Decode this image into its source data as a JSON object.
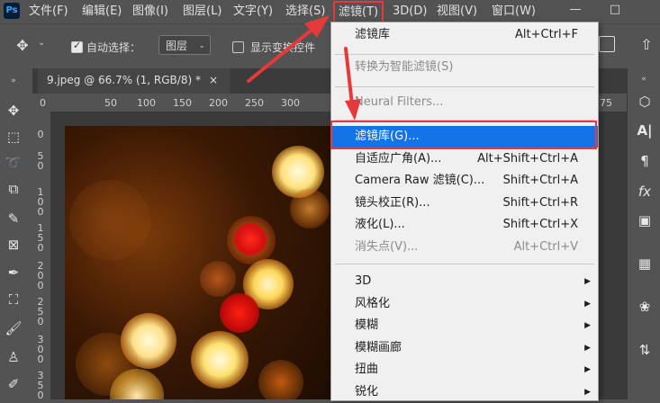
{
  "menubar": {
    "logo": "Ps",
    "items": [
      "文件(F)",
      "编辑(E)",
      "图像(I)",
      "图层(L)",
      "文字(Y)",
      "选择(S)",
      "滤镜(T)",
      "3D(D)",
      "视图(V)",
      "窗口(W)"
    ],
    "window_buttons": [
      "—",
      "□"
    ]
  },
  "options": {
    "auto_select_label": "自动选择：",
    "auto_select_checked": true,
    "layer_select_value": "图层",
    "show_transform_label": "显示变换控件",
    "show_transform_checked": false
  },
  "doc_tab": {
    "title": "9.jpeg @ 66.7% (1, RGB/8) *",
    "close": "×"
  },
  "ruler": {
    "top_labels": [
      "0",
      "50",
      "100",
      "150",
      "200",
      "250",
      "300",
      "75"
    ],
    "left_labels": [
      "0",
      "5",
      "0",
      "1",
      "0",
      "0",
      "1",
      "5",
      "0",
      "2",
      "0",
      "0",
      "2",
      "5",
      "0",
      "3",
      "0",
      "0",
      "3",
      "5",
      "0"
    ]
  },
  "filter_menu": {
    "items": [
      {
        "label": "滤镜库",
        "shortcut": "Alt+Ctrl+F",
        "disabled": false
      },
      {
        "label": "转换为智能滤镜(S)",
        "shortcut": "",
        "disabled": true
      },
      {
        "label": "Neural Filters...",
        "shortcut": "",
        "disabled": true
      },
      {
        "label": "滤镜库(G)...",
        "shortcut": "",
        "disabled": false,
        "highlighted": true
      },
      {
        "label": "自适应广角(A)...",
        "shortcut": "Alt+Shift+Ctrl+A",
        "disabled": false
      },
      {
        "label": "Camera Raw 滤镜(C)...",
        "shortcut": "Shift+Ctrl+A",
        "disabled": false
      },
      {
        "label": "镜头校正(R)...",
        "shortcut": "Shift+Ctrl+R",
        "disabled": false
      },
      {
        "label": "液化(L)...",
        "shortcut": "Shift+Ctrl+X",
        "disabled": false
      },
      {
        "label": "消失点(V)...",
        "shortcut": "Alt+Ctrl+V",
        "disabled": true
      },
      {
        "label": "3D",
        "submenu": true
      },
      {
        "label": "风格化",
        "submenu": true
      },
      {
        "label": "模糊",
        "submenu": true
      },
      {
        "label": "模糊画廊",
        "submenu": true
      },
      {
        "label": "扭曲",
        "submenu": true
      },
      {
        "label": "锐化",
        "submenu": true
      }
    ]
  },
  "colors": {
    "highlight": "#1473e6",
    "annotation_red": "#e63a3a",
    "menubar_bg": "#535353",
    "menu_bg": "#f0f0f0"
  },
  "icons": {
    "left_toolbar": [
      "move-icon",
      "marquee-icon",
      "lasso-icon",
      "object-select-icon",
      "eyedropper-icon",
      "frame-icon",
      "eyedropper2-icon",
      "crop-icon",
      "brush-icon",
      "stamp-icon",
      "history-brush-icon"
    ],
    "right_panel": [
      "3d-cube-icon",
      "character-icon",
      "paragraph-icon",
      "fx-icon",
      "adjustments-icon",
      "table-icon",
      "paint-palette-icon",
      "layer-comps-icon"
    ]
  }
}
